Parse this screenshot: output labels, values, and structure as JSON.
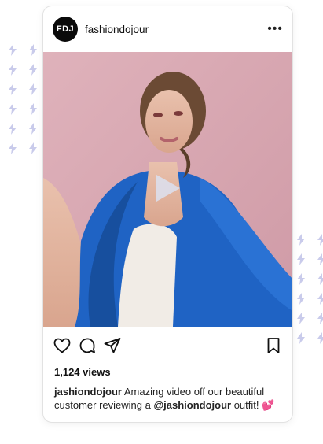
{
  "decoration": {
    "bolt_color": "#c9cbeb"
  },
  "post": {
    "avatar_text": "FDJ",
    "username": "fashiondojour",
    "more_label": "•••",
    "views": "1,124 views",
    "caption": {
      "user": "jashiondojour",
      "text_before": " Amazing video off our beautiful customer reviewing a ",
      "mention": "@jashiondojour",
      "text_after": " outfit! ",
      "emoji": "💕"
    }
  },
  "icons": [
    "heart-icon",
    "comment-icon",
    "share-icon",
    "bookmark-icon",
    "play-icon",
    "more-icon"
  ],
  "colors": {
    "blazer": "#1f63c4",
    "background": "#d9a9b3"
  }
}
